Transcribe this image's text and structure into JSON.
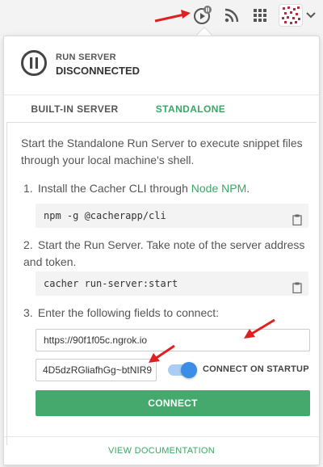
{
  "topbar": {
    "icons": [
      "run-server-icon",
      "rss-icon",
      "apps-grid-icon",
      "avatar",
      "chevron-down-icon"
    ]
  },
  "status": {
    "title": "RUN SERVER",
    "value": "DISCONNECTED"
  },
  "tabs": [
    {
      "label": "BUILT-IN SERVER",
      "active": false
    },
    {
      "label": "STANDALONE",
      "active": true
    }
  ],
  "content": {
    "intro": "Start the Standalone Run Server to execute snippet files through your local machine's shell.",
    "step1": {
      "num": "1.",
      "text": "Install the Cacher CLI through ",
      "link": "Node NPM",
      "suffix": ".",
      "code": "npm -g @cacherapp/cli"
    },
    "step2": {
      "num": "2.",
      "text": "Start the Run Server. Take note of the server address and token.",
      "code": "cacher run-server:start"
    },
    "step3": {
      "num": "3.",
      "text": "Enter the following fields to connect:"
    },
    "server_url": "https://90f1f05c.ngrok.io",
    "token": "4D5dzRGliafhGg~btNIR9",
    "toggle_label": "CONNECT ON STARTUP",
    "toggle_on": true,
    "connect_label": "CONNECT"
  },
  "footer": {
    "doc_link": "VIEW DOCUMENTATION"
  },
  "colors": {
    "accent": "#3aa865",
    "button": "#45a96e",
    "toggle": "#3a8ee6",
    "annotation": "#e02020"
  }
}
